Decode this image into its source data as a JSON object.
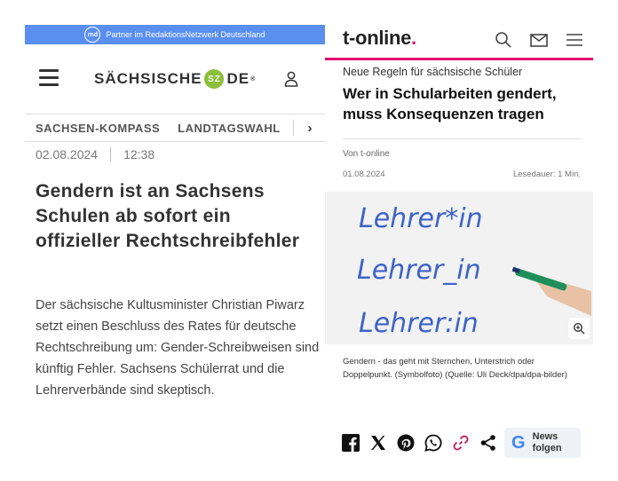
{
  "left": {
    "partner_banner": {
      "logo": "rnd",
      "text": "Partner im RedaktionsNetzwerk Deutschland",
      "color": "#5a8ff0"
    },
    "brand": {
      "name_part1": "SÄCHSISCHE",
      "badge": "SZ",
      "name_part2": "DE",
      "superscript": "®",
      "badge_color": "#8bbf3a"
    },
    "nav": {
      "items": [
        "SACHSEN-KOMPASS",
        "LANDTAGSWAHL"
      ]
    },
    "date": "02.08.2024",
    "time": "12:38",
    "headline": "Gendern ist an Sachsens Schulen ab sofort ein offizieller Rechtschreibfehler",
    "teaser": "Der sächsische Kultusminister Christian Piwarz setzt einen Beschluss des Rates für deutsche Rechtschreibung um: Gender-Schreibweisen sind künftig Fehler. Sachsens Schülerrat und die Lehrerverbände sind skeptisch."
  },
  "right": {
    "brand": {
      "name": "t-online",
      "dot": ".",
      "accent": "#e3106e"
    },
    "kicker": "Neue Regeln für sächsische Schüler",
    "headline": "Wer in Schularbeiten gendert, muss Konsequenzen tragen",
    "author": "Von t-online",
    "date": "01.08.2024",
    "reading_time": "Lesedauer: 1 Min.",
    "photo_lines": [
      "Lehrer*in",
      "Lehrer_in",
      "Lehrer:in"
    ],
    "caption": "Gendern - das geht mit Sternchen, Unterstrich oder Doppelpunkt. (Symbolfoto) (Quelle: Uli Deck/dpa/dpa-bilder)",
    "share_icons": [
      "facebook-icon",
      "x-icon",
      "pinterest-icon",
      "whatsapp-icon",
      "link-icon",
      "share-icon"
    ],
    "news_button": {
      "g": "G",
      "label": "News folgen"
    }
  }
}
